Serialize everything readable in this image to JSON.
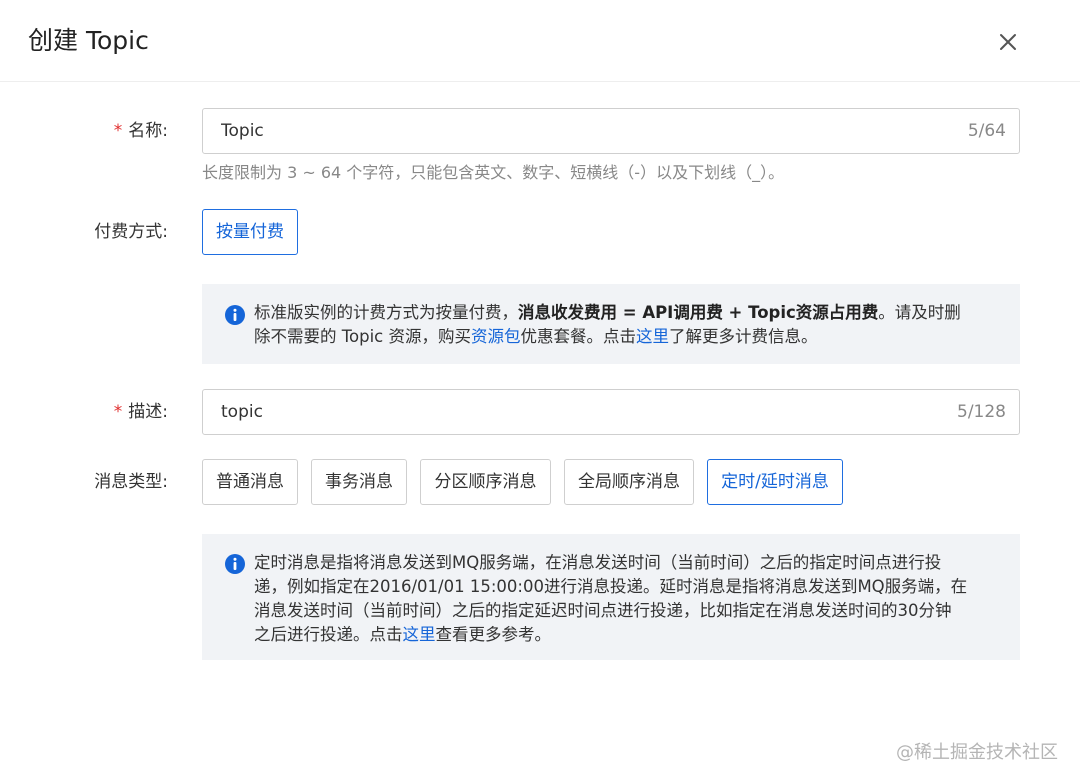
{
  "dialog": {
    "title": "创建 Topic"
  },
  "name_field": {
    "label": "名称:",
    "required_mark": "*",
    "value": "Topic",
    "counter": "5/64",
    "hint": "长度限制为 3 ~ 64 个字符，只能包含英文、数字、短横线（-）以及下划线（_）。"
  },
  "billing": {
    "label": "付费方式:",
    "option": "按量付费",
    "info": {
      "text_1": "标准版实例的计费方式为按量付费，",
      "bold": "消息收发费用 = API调用费 + Topic资源占用费",
      "text_2": "。请及时删",
      "text_3": "除不需要的 Topic 资源，购买",
      "link_1": "资源包",
      "text_4": "优惠套餐。点击",
      "link_2": "这里",
      "text_5": "了解更多计费信息。"
    }
  },
  "desc_field": {
    "label": "描述:",
    "required_mark": "*",
    "value": "topic",
    "counter": "5/128"
  },
  "message_type": {
    "label": "消息类型:",
    "options": [
      "普通消息",
      "事务消息",
      "分区顺序消息",
      "全局顺序消息",
      "定时/延时消息"
    ],
    "selected": "定时/延时消息",
    "info": {
      "line_1": "定时消息是指将消息发送到MQ服务端，在消息发送时间（当前时间）之后的指定时间点进行投",
      "line_2": "递，例如指定在2016/01/01 15:00:00进行消息投递。延时消息是指将消息发送到MQ服务端，在",
      "line_3": "消息发送时间（当前时间）之后的指定延迟时间点进行投递，比如指定在消息发送时间的30分钟",
      "line_4_a": "之后进行投递。点击",
      "link": "这里",
      "line_4_b": "查看更多参考。"
    }
  },
  "watermark": "@稀土掘金技术社区",
  "colors": {
    "accent": "#1565d8",
    "required": "#e02e2e",
    "info_bg": "#f1f3f6",
    "border": "#cfcfcf"
  },
  "icons": {
    "close": "close-icon",
    "info": "info-icon"
  }
}
